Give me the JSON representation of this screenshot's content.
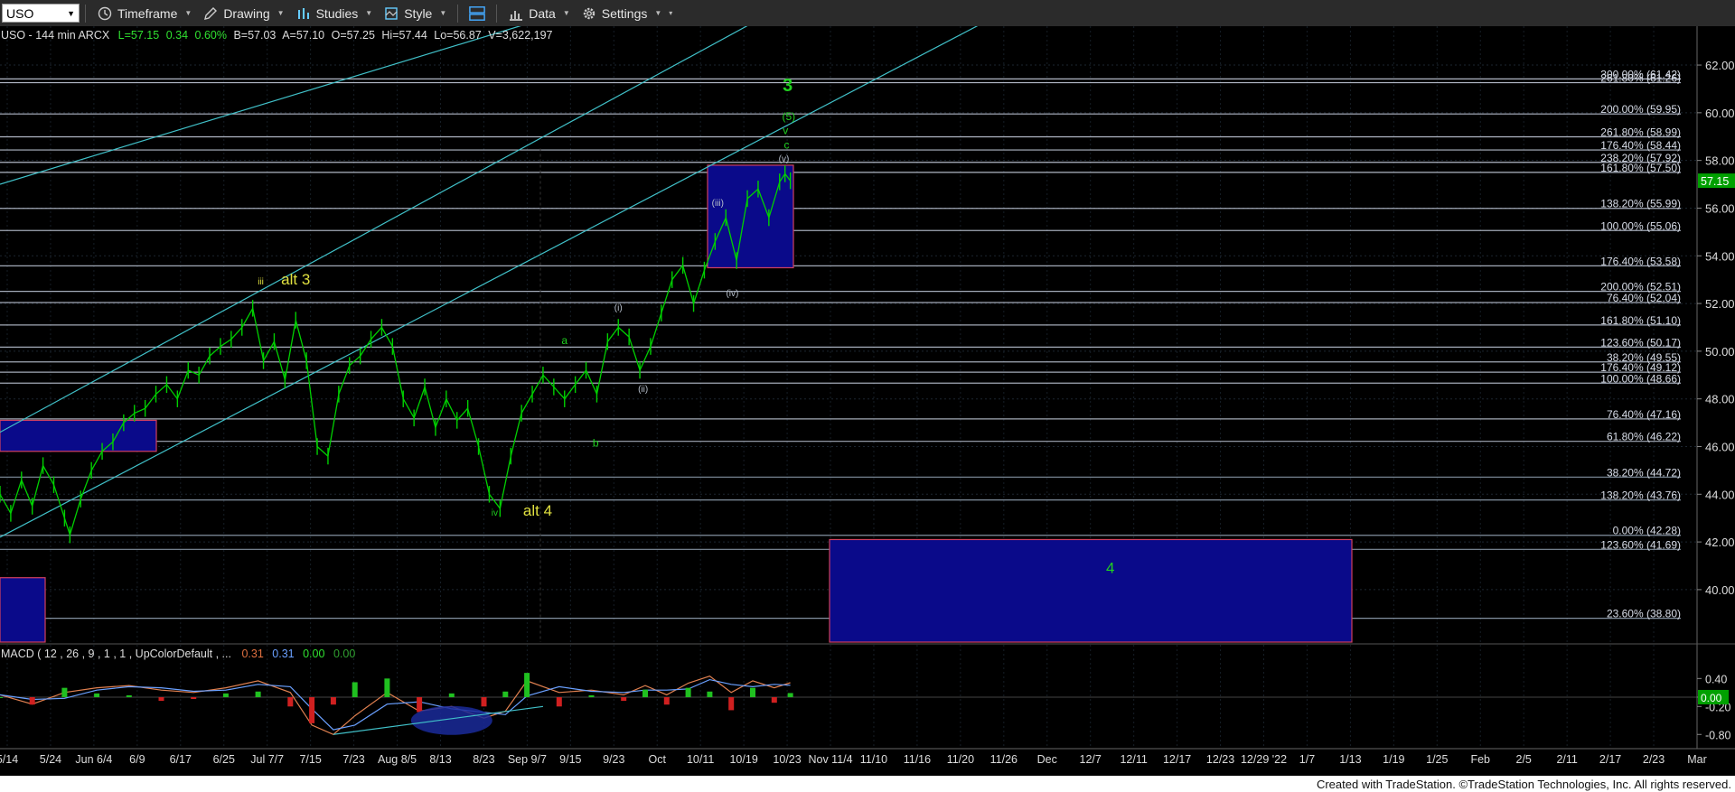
{
  "toolbar": {
    "symbol": "USO",
    "timeframe": "Timeframe",
    "drawing": "Drawing",
    "studies": "Studies",
    "style": "Style",
    "data": "Data",
    "settings": "Settings"
  },
  "header": {
    "symbol_line": "USO - 144 min  ARCX",
    "last": "L=57.15",
    "change": "0.34",
    "pct": "0.60%",
    "bid": "B=57.03",
    "ask": "A=57.10",
    "open": "O=57.25",
    "hi": "Hi=57.44",
    "lo": "Lo=56.87",
    "vol": "V=3,622,197"
  },
  "macd_header": {
    "label": "MACD ( 12 , 26 , 9 , 1 , 1 , UpColorDefault , ...",
    "v1": "0.31",
    "v2": "0.31",
    "v3": "0.00",
    "v4": "0.00"
  },
  "footer": "Created with TradeStation. ©TradeStation Technologies, Inc. All rights reserved.",
  "colors": {
    "price": "#00d000",
    "channel": "#40c0c8",
    "fib": "#c8d0e0",
    "box": "#0a0a8a",
    "box_border": "#d04060",
    "wave_green": "#20d020",
    "wave_yellow": "#e0e040"
  },
  "chart_data": {
    "type": "line",
    "price_axis": {
      "ylim": [
        37.8,
        63.1
      ],
      "ticks": [
        "62.00",
        "60.00",
        "58.00",
        "56.00",
        "54.00",
        "52.00",
        "50.00",
        "48.00",
        "46.00",
        "44.00",
        "42.00",
        "40.00"
      ],
      "last_price": "57.15"
    },
    "macd_axis": {
      "ylim": [
        -0.95,
        0.6
      ],
      "ticks": [
        "0.40",
        "0.00",
        "-0.20",
        "-0.80"
      ],
      "last_value": "0.00"
    },
    "x_ticks": [
      "5/14",
      "5/24",
      "Jun 6/4",
      "6/9",
      "6/17",
      "6/25",
      "Jul 7/7",
      "7/15",
      "7/23",
      "Aug 8/5",
      "8/13",
      "8/23",
      "Sep 9/7",
      "9/15",
      "9/23",
      "Oct",
      "10/11",
      "10/19",
      "10/23",
      "Nov 11/4",
      "11/10",
      "11/16",
      "11/20",
      "11/26",
      "Dec",
      "12/7",
      "12/11",
      "12/17",
      "12/23",
      "12/29 '22",
      "1/7",
      "1/13",
      "1/19",
      "1/25",
      "Feb",
      "2/5",
      "2/11",
      "2/17",
      "2/23",
      "Mar"
    ],
    "fib_levels": [
      {
        "label": "300.00% (61.42)",
        "value": 61.42
      },
      {
        "label": "261.80% (61.26)",
        "value": 61.26
      },
      {
        "label": "200.00% (59.95)",
        "value": 59.95
      },
      {
        "label": "261.80% (58.99)",
        "value": 58.99
      },
      {
        "label": "176.40% (58.44)",
        "value": 58.44
      },
      {
        "label": "238.20% (57.92)",
        "value": 57.92
      },
      {
        "label": "161.80% (57.50)",
        "value": 57.5
      },
      {
        "label": "138.20% (55.99)",
        "value": 55.99
      },
      {
        "label": "100.00% (55.06)",
        "value": 55.06
      },
      {
        "label": "176.40% (53.58)",
        "value": 53.58
      },
      {
        "label": "200.00% (52.51)",
        "value": 52.51
      },
      {
        "label": "76.40% (52.04)",
        "value": 52.04
      },
      {
        "label": "161.80% (51.10)",
        "value": 51.1
      },
      {
        "label": "123.60% (50.17)",
        "value": 50.17
      },
      {
        "label": "38.20% (49.55)",
        "value": 49.55
      },
      {
        "label": "176.40% (49.12)",
        "value": 49.12
      },
      {
        "label": "100.00% (48.66)",
        "value": 48.66
      },
      {
        "label": "76.40% (47.16)",
        "value": 47.16
      },
      {
        "label": "61.80% (46.22)",
        "value": 46.22
      },
      {
        "label": "38.20% (44.72)",
        "value": 44.72
      },
      {
        "label": "138.20% (43.76)",
        "value": 43.76
      },
      {
        "label": "0.00% (42.28)",
        "value": 42.28
      },
      {
        "label": "123.60% (41.69)",
        "value": 41.69
      },
      {
        "label": "23.60% (38.80)",
        "value": 38.8
      }
    ],
    "price_series": [
      [
        0,
        44.0
      ],
      [
        2,
        43.2
      ],
      [
        4,
        44.6
      ],
      [
        6,
        43.5
      ],
      [
        8,
        45.2
      ],
      [
        10,
        44.4
      ],
      [
        12,
        43.0
      ],
      [
        13,
        42.3
      ],
      [
        15,
        43.8
      ],
      [
        17,
        45.0
      ],
      [
        19,
        45.8
      ],
      [
        21,
        46.2
      ],
      [
        23,
        47.0
      ],
      [
        25,
        47.4
      ],
      [
        27,
        47.6
      ],
      [
        29,
        48.2
      ],
      [
        31,
        48.6
      ],
      [
        33,
        48.0
      ],
      [
        35,
        49.2
      ],
      [
        37,
        49.0
      ],
      [
        39,
        49.8
      ],
      [
        41,
        50.2
      ],
      [
        43,
        50.5
      ],
      [
        45,
        51.0
      ],
      [
        47,
        51.8
      ],
      [
        49,
        49.6
      ],
      [
        51,
        50.4
      ],
      [
        53,
        48.8
      ],
      [
        55,
        51.3
      ],
      [
        57,
        49.6
      ],
      [
        59,
        46.0
      ],
      [
        61,
        45.6
      ],
      [
        63,
        48.2
      ],
      [
        65,
        49.4
      ],
      [
        67,
        49.8
      ],
      [
        69,
        50.5
      ],
      [
        71,
        51.0
      ],
      [
        73,
        50.2
      ],
      [
        75,
        48.0
      ],
      [
        77,
        47.2
      ],
      [
        79,
        48.5
      ],
      [
        81,
        46.8
      ],
      [
        83,
        48.0
      ],
      [
        85,
        47.1
      ],
      [
        87,
        47.6
      ],
      [
        89,
        46.0
      ],
      [
        91,
        44.0
      ],
      [
        93,
        43.4
      ],
      [
        95,
        45.6
      ],
      [
        97,
        47.4
      ],
      [
        99,
        48.2
      ],
      [
        101,
        49.0
      ],
      [
        103,
        48.5
      ],
      [
        105,
        48.0
      ],
      [
        107,
        48.6
      ],
      [
        109,
        49.2
      ],
      [
        111,
        48.2
      ],
      [
        113,
        50.4
      ],
      [
        115,
        51.0
      ],
      [
        117,
        50.6
      ],
      [
        119,
        49.2
      ],
      [
        121,
        50.2
      ],
      [
        123,
        51.6
      ],
      [
        125,
        53.0
      ],
      [
        127,
        53.6
      ],
      [
        129,
        52.0
      ],
      [
        131,
        53.4
      ],
      [
        133,
        54.6
      ],
      [
        135,
        55.6
      ],
      [
        137,
        53.8
      ],
      [
        139,
        56.4
      ],
      [
        141,
        56.8
      ],
      [
        143,
        55.6
      ],
      [
        145,
        57.1
      ],
      [
        146,
        57.44
      ],
      [
        147,
        57.15
      ]
    ],
    "macd_series": [
      [
        0,
        0.05
      ],
      [
        6,
        -0.15
      ],
      [
        12,
        0.1
      ],
      [
        18,
        0.2
      ],
      [
        24,
        0.25
      ],
      [
        30,
        0.15
      ],
      [
        36,
        0.1
      ],
      [
        42,
        0.2
      ],
      [
        48,
        0.35
      ],
      [
        54,
        0.1
      ],
      [
        58,
        -0.6
      ],
      [
        62,
        -0.8
      ],
      [
        66,
        -0.4
      ],
      [
        72,
        0.1
      ],
      [
        78,
        -0.3
      ],
      [
        84,
        -0.2
      ],
      [
        90,
        -0.45
      ],
      [
        94,
        -0.3
      ],
      [
        98,
        0.35
      ],
      [
        104,
        0.1
      ],
      [
        110,
        0.15
      ],
      [
        116,
        0.05
      ],
      [
        120,
        0.25
      ],
      [
        124,
        0.05
      ],
      [
        128,
        0.3
      ],
      [
        132,
        0.45
      ],
      [
        136,
        0.1
      ],
      [
        140,
        0.35
      ],
      [
        144,
        0.2
      ],
      [
        147,
        0.31
      ]
    ],
    "wave_labels": [
      {
        "text": "3",
        "x": 146.5,
        "y": 60.9,
        "color": "green",
        "size": "big"
      },
      {
        "text": "(5)",
        "x": 146.7,
        "y": 59.7,
        "color": "green",
        "size": "small"
      },
      {
        "text": "v",
        "x": 146.1,
        "y": 59.1,
        "color": "green",
        "size": "small"
      },
      {
        "text": "c",
        "x": 146.3,
        "y": 58.5,
        "color": "green",
        "size": "small"
      },
      {
        "text": "(v)",
        "x": 145.8,
        "y": 57.95,
        "color": "gray",
        "size": "tiny"
      },
      {
        "text": "(iii)",
        "x": 133.5,
        "y": 56.1,
        "color": "gray",
        "size": "tiny"
      },
      {
        "text": "(iv)",
        "x": 136.2,
        "y": 52.3,
        "color": "gray",
        "size": "tiny"
      },
      {
        "text": "(i)",
        "x": 115.0,
        "y": 51.7,
        "color": "gray",
        "size": "tiny"
      },
      {
        "text": "(ii)",
        "x": 119.6,
        "y": 48.3,
        "color": "gray",
        "size": "tiny"
      },
      {
        "text": "a",
        "x": 105.0,
        "y": 50.3,
        "color": "green",
        "size": "small"
      },
      {
        "text": "b",
        "x": 110.8,
        "y": 46.0,
        "color": "green",
        "size": "small"
      },
      {
        "text": "iii",
        "x": 48.5,
        "y": 52.8,
        "color": "yellow",
        "size": "tiny"
      },
      {
        "text": "alt 3",
        "x": 55.0,
        "y": 52.8,
        "color": "yellow",
        "size": "mid"
      },
      {
        "text": "iv",
        "x": 92.0,
        "y": 43.1,
        "color": "green",
        "size": "tiny"
      },
      {
        "text": "alt 4",
        "x": 100.0,
        "y": 43.1,
        "color": "yellow",
        "size": "mid"
      },
      {
        "text": "4",
        "x": 206.5,
        "y": 40.7,
        "color": "green",
        "size": "mid"
      }
    ]
  }
}
